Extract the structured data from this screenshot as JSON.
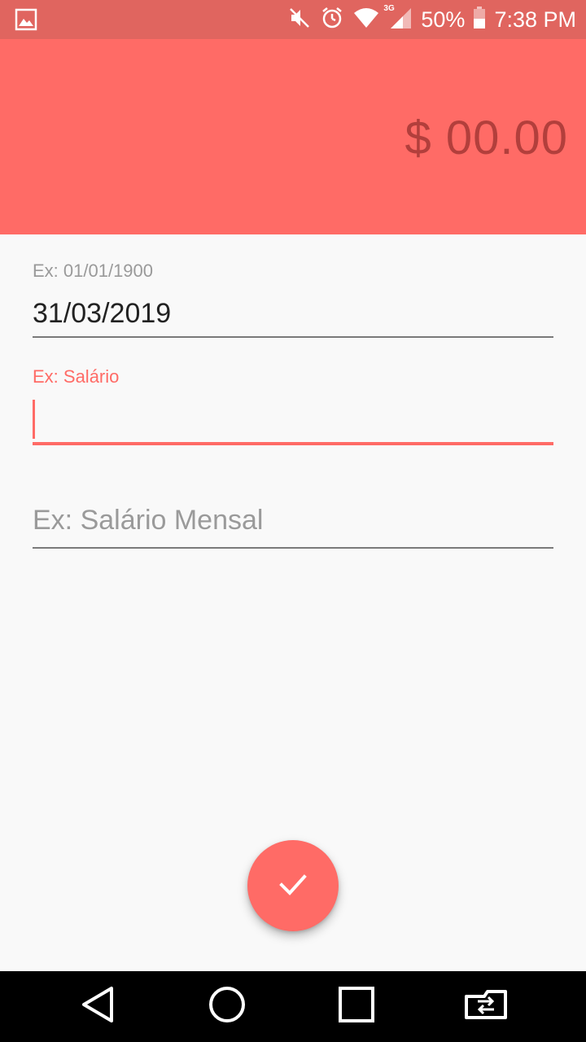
{
  "status_bar": {
    "battery": "50%",
    "time": "7:38 PM",
    "network": "3G",
    "icons": [
      "image-icon",
      "mute-icon",
      "alarm-icon",
      "wifi-icon",
      "signal-icon",
      "battery-icon"
    ]
  },
  "header": {
    "amount": "$ 00.00"
  },
  "form": {
    "date": {
      "label": "Ex: 01/01/1900",
      "value": "31/03/2019"
    },
    "value": {
      "label": "Ex: Salário",
      "value": ""
    },
    "description": {
      "placeholder": "Ex: Salário Mensal"
    }
  },
  "fab": {
    "icon": "check-icon"
  },
  "nav": {
    "icons": [
      "back-icon",
      "home-icon",
      "recents-icon",
      "switch-icon"
    ]
  },
  "colors": {
    "accent": "#ff6b66",
    "status_bar": "#e0655f",
    "amount_text": "#b23f3c",
    "background": "#f9f9f9"
  }
}
